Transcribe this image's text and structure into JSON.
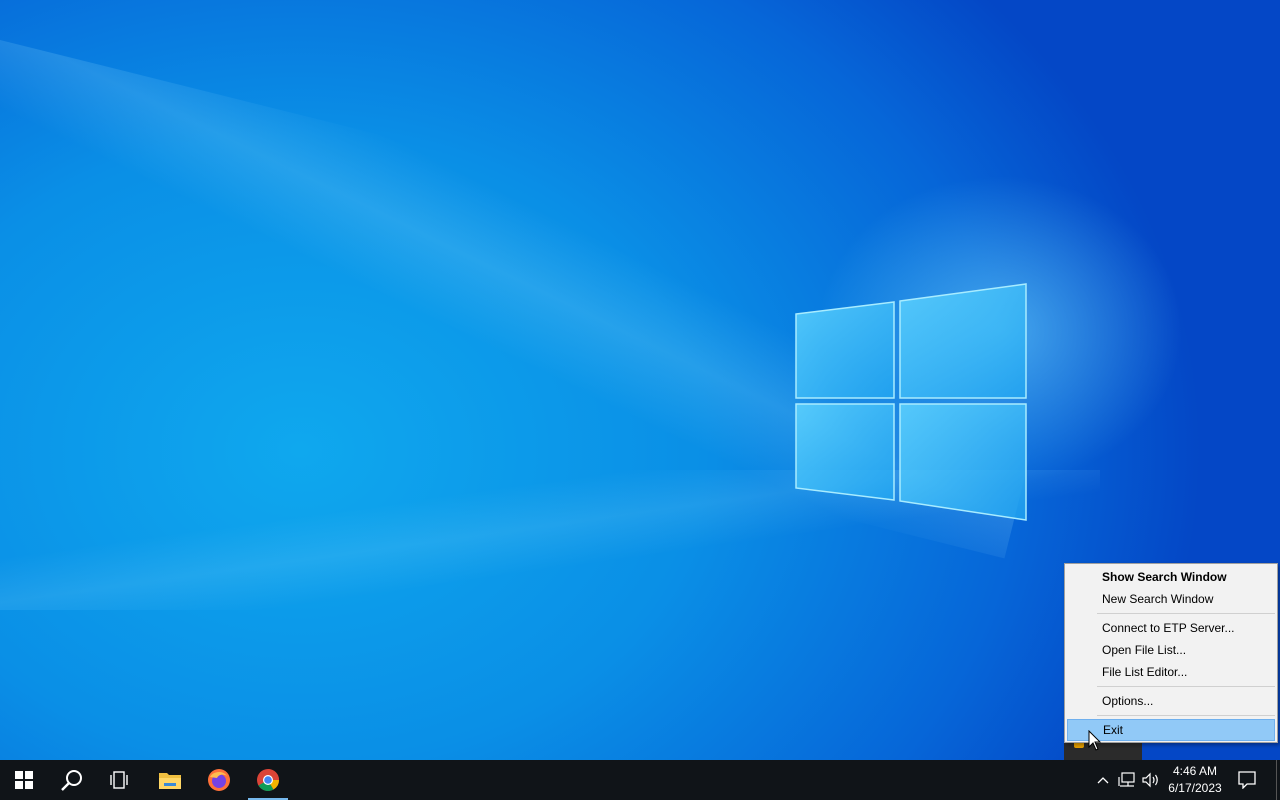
{
  "context_menu": {
    "items": [
      {
        "label": "Show Search Window",
        "bold": true
      },
      {
        "label": "New Search Window"
      },
      {
        "label": "Connect to ETP Server..."
      },
      {
        "label": "Open File List..."
      },
      {
        "label": "File List Editor..."
      },
      {
        "label": "Options..."
      },
      {
        "label": "Exit",
        "highlighted": true
      }
    ]
  },
  "taskbar": {
    "apps": [
      {
        "icon": "start-windows-icon"
      },
      {
        "icon": "search-icon"
      },
      {
        "icon": "task-view-icon"
      },
      {
        "icon": "file-explorer-icon"
      },
      {
        "icon": "firefox-icon"
      },
      {
        "icon": "chrome-icon",
        "active": true
      }
    ],
    "clock": {
      "time": "4:46 AM",
      "date": "6/17/2023"
    }
  },
  "colors": {
    "menu_highlight": "#91c9f7",
    "taskbar_bg": "#101418",
    "active_indicator": "#76b9ed"
  }
}
